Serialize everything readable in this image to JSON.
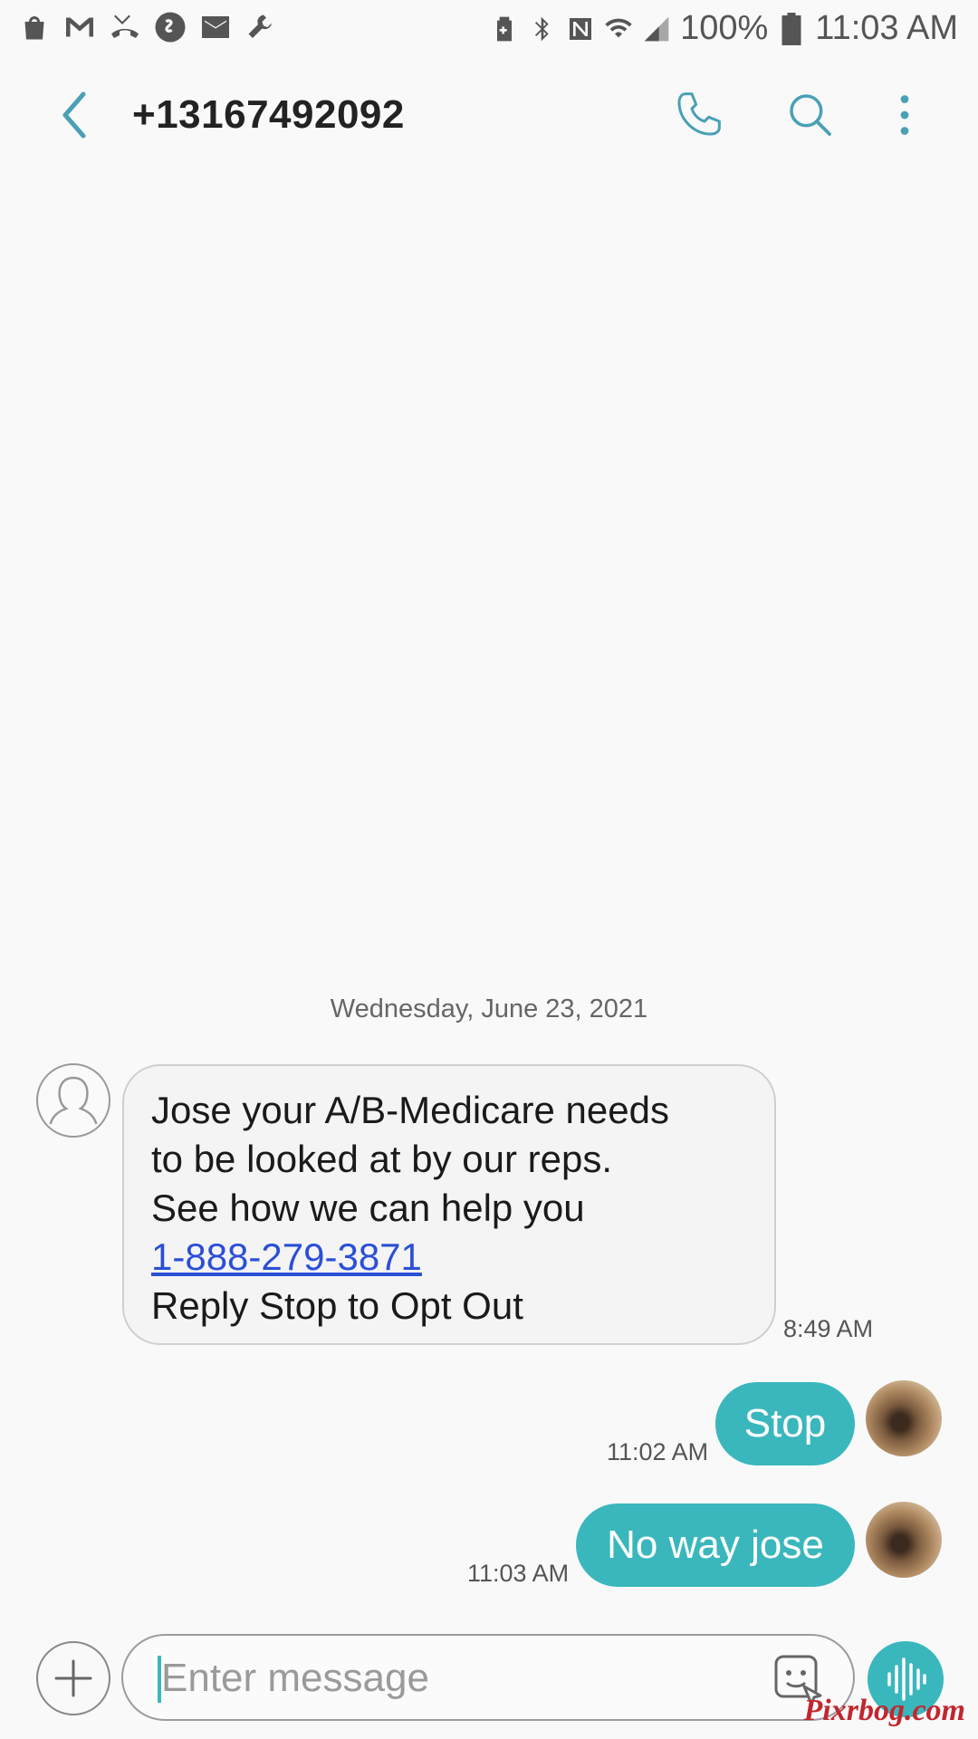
{
  "status_bar": {
    "battery": "100%",
    "time": "11:03 AM"
  },
  "header": {
    "contact": "+13167492092"
  },
  "conversation": {
    "date": "Wednesday, June 23, 2021",
    "incoming": {
      "lines": [
        "Jose your A/B-Medicare needs",
        "to be looked at by our reps.",
        "See how we can help you"
      ],
      "phone_link": "1-888-279-3871",
      "last_line": "Reply Stop to Opt Out",
      "time": "8:49 AM"
    },
    "outgoing": [
      {
        "text": "Stop",
        "time": "11:02 AM"
      },
      {
        "text": "No way jose",
        "time": "11:03 AM"
      }
    ]
  },
  "composer": {
    "placeholder": "Enter message"
  },
  "watermark": "Pixrbog.com",
  "colors": {
    "accent": "#3ab7bd",
    "link": "#2b4fd6",
    "icon": "#4aa0b5"
  }
}
